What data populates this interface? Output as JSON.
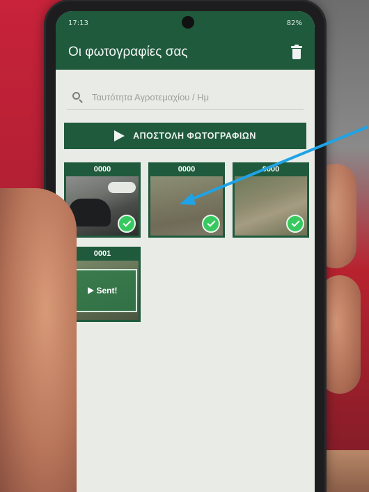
{
  "status_bar": {
    "time": "17:13",
    "indicators": "82%"
  },
  "app_bar": {
    "title": "Οι φωτογραφίες σας",
    "action_icon": "trash-icon"
  },
  "search": {
    "placeholder": "Ταυτότητα Αγροτεμαχίου / Ημ"
  },
  "send_button": {
    "label": "ΑΠΟΣΤΟΛΗ ΦΩΤΟΓΡΑΦΙΩΝ",
    "icon": "send-icon"
  },
  "photos": [
    {
      "label": "0000",
      "status": "check"
    },
    {
      "label": "0000",
      "status": "check"
    },
    {
      "label": "0000",
      "status": "check"
    },
    {
      "label": "0001",
      "status": "sent",
      "overlay_text": "Sent!"
    }
  ],
  "colors": {
    "primary": "#1f5a3d",
    "check": "#37c95f",
    "annotation_arrow": "#1fa3e6"
  }
}
